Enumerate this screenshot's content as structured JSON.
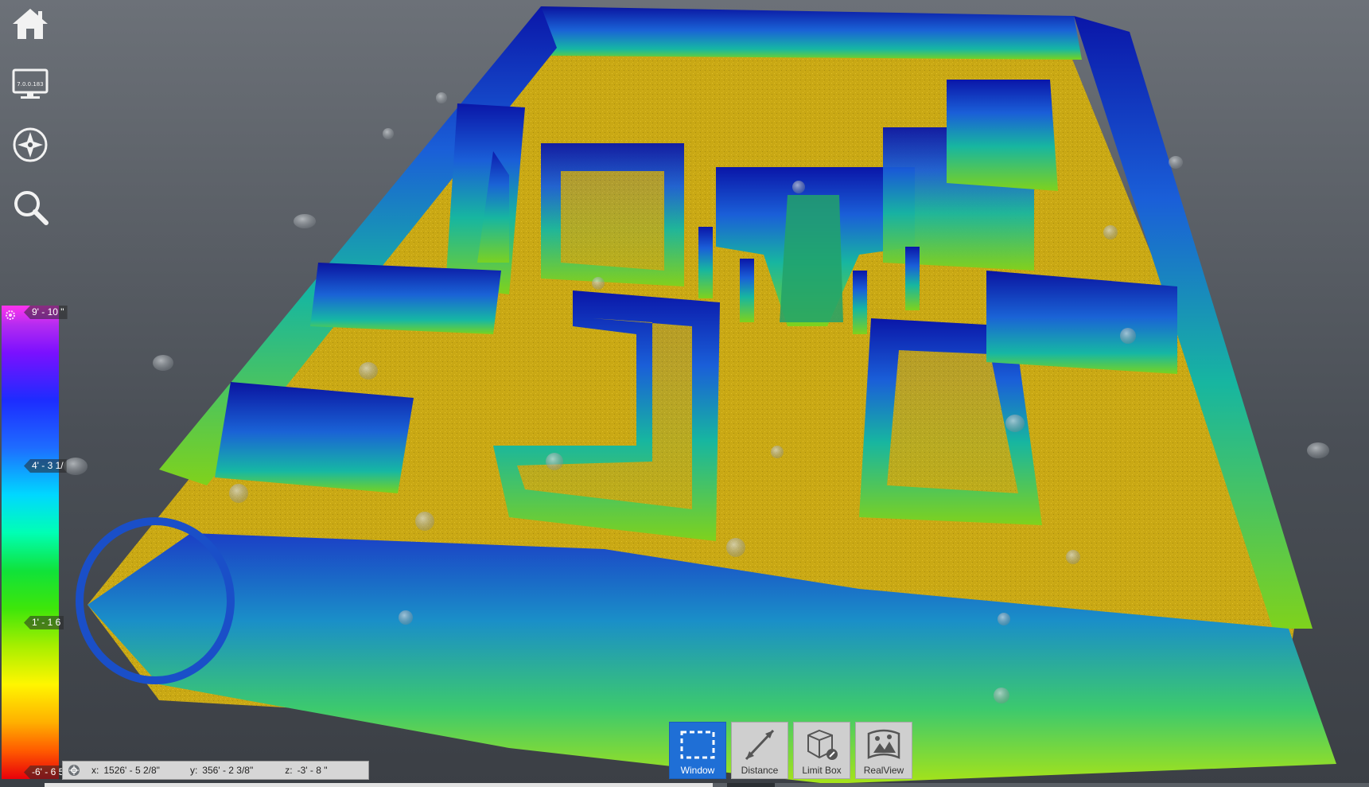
{
  "app": {
    "nav": {
      "home_icon": "home-icon",
      "monitor_icon": "monitor-icon",
      "monitor_text": "7.0.0.183",
      "compass_icon": "compass-icon",
      "search_icon": "search-icon"
    },
    "legend": {
      "ticks": [
        "9' - 10 \"",
        "4' - 3 1/",
        "1' - 1 6",
        "-6' - 6 5"
      ]
    },
    "coords": {
      "x_label": "x:",
      "x_value": "1526' - 5 2/8\"",
      "y_label": "y:",
      "y_value": "356' - 2 3/8\"",
      "z_label": "z:",
      "z_value": "-3' - 8 \""
    },
    "toolbar": {
      "items": [
        {
          "label": "Window",
          "icon": "selection-window-icon",
          "active": true
        },
        {
          "label": "Distance",
          "icon": "distance-icon",
          "active": false
        },
        {
          "label": "Limit Box",
          "icon": "limit-box-icon",
          "active": false
        },
        {
          "label": "RealView",
          "icon": "realview-icon",
          "active": false
        }
      ]
    },
    "colors": {
      "floor": "#c9a814",
      "active_tool": "#1f6fd6"
    }
  }
}
